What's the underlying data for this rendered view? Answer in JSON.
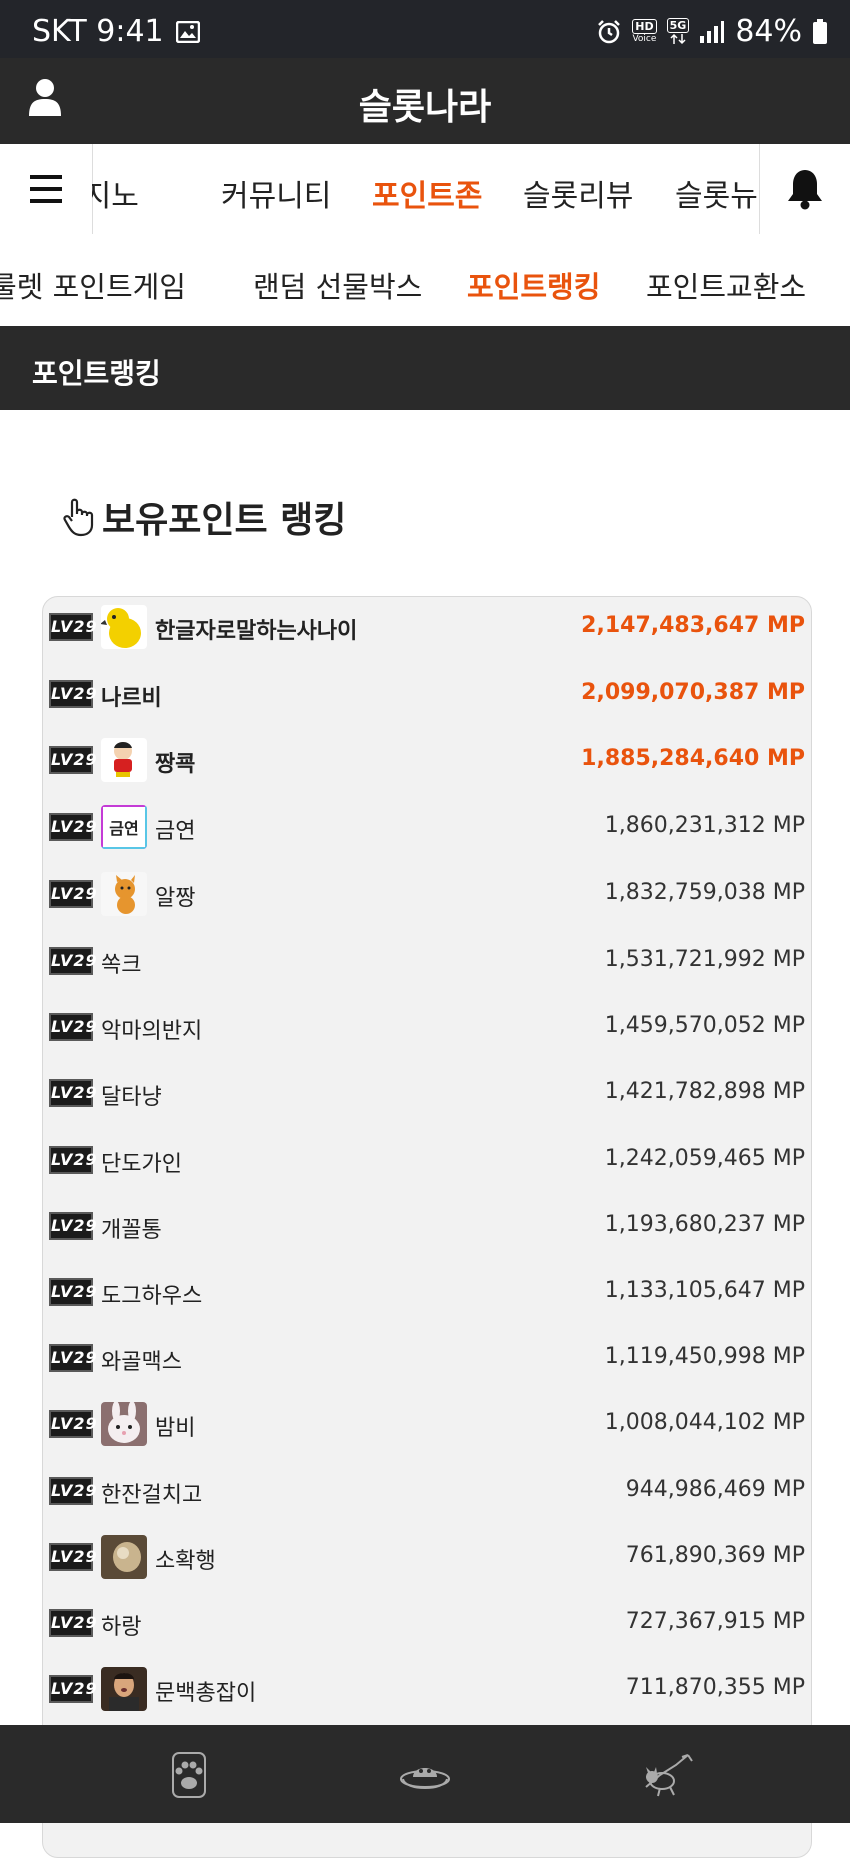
{
  "status_bar": {
    "carrier_time": "SKT 9:41",
    "hd_label": "HD",
    "voice_label": "Voice",
    "network": "5G",
    "battery": "84%"
  },
  "header": {
    "title": "슬롯나라",
    "user_icon": "user-icon"
  },
  "main_nav": {
    "items": [
      "카지노",
      "커뮤니티",
      "포인트존",
      "슬롯리뷰",
      "슬롯뉴스"
    ],
    "active": "포인트존"
  },
  "sub_nav": {
    "items": [
      "룰렛 포인트게임",
      "랜덤 선물박스",
      "포인트랭킹",
      "포인트교환소"
    ],
    "active": "포인트랭킹"
  },
  "page_header": {
    "title": "포인트랭킹"
  },
  "section": {
    "title": "보유포인트 랭킹"
  },
  "level_badge": "LV29",
  "colors": {
    "accent": "#e9530d",
    "dark_bar": "#2a2a2a"
  },
  "rankings": [
    {
      "name": "한글자로말하는사나이",
      "points": "2,147,483,647 MP",
      "avatar": "yellow-bird"
    },
    {
      "name": "나르비",
      "points": "2,099,070,387 MP",
      "avatar": ""
    },
    {
      "name": "짱쿅",
      "points": "1,885,284,640 MP",
      "avatar": "cartoon-boy"
    },
    {
      "name": "금연",
      "points": "1,860,231,312 MP",
      "avatar": "text-logo"
    },
    {
      "name": "알짱",
      "points": "1,832,759,038 MP",
      "avatar": "orange-cat"
    },
    {
      "name": "쏙크",
      "points": "1,531,721,992 MP",
      "avatar": ""
    },
    {
      "name": "악마의반지",
      "points": "1,459,570,052 MP",
      "avatar": ""
    },
    {
      "name": "달타냥",
      "points": "1,421,782,898 MP",
      "avatar": ""
    },
    {
      "name": "단도가인",
      "points": "1,242,059,465 MP",
      "avatar": ""
    },
    {
      "name": "개꼴통",
      "points": "1,193,680,237 MP",
      "avatar": ""
    },
    {
      "name": "도그하우스",
      "points": "1,133,105,647 MP",
      "avatar": ""
    },
    {
      "name": "와골맥스",
      "points": "1,119,450,998 MP",
      "avatar": ""
    },
    {
      "name": "밤비",
      "points": "1,008,044,102 MP",
      "avatar": "white-rabbit"
    },
    {
      "name": "한잔걸치고",
      "points": "944,986,469 MP",
      "avatar": ""
    },
    {
      "name": "소확행",
      "points": "761,890,369 MP",
      "avatar": "brown-photo"
    },
    {
      "name": "하랑",
      "points": "727,367,915 MP",
      "avatar": ""
    },
    {
      "name": "문백총잡이",
      "points": "711,870,355 MP",
      "avatar": "man-photo"
    }
  ],
  "bottom_bar": {
    "icons": [
      "paw-icon",
      "bowl-icon",
      "cat-icon"
    ]
  }
}
